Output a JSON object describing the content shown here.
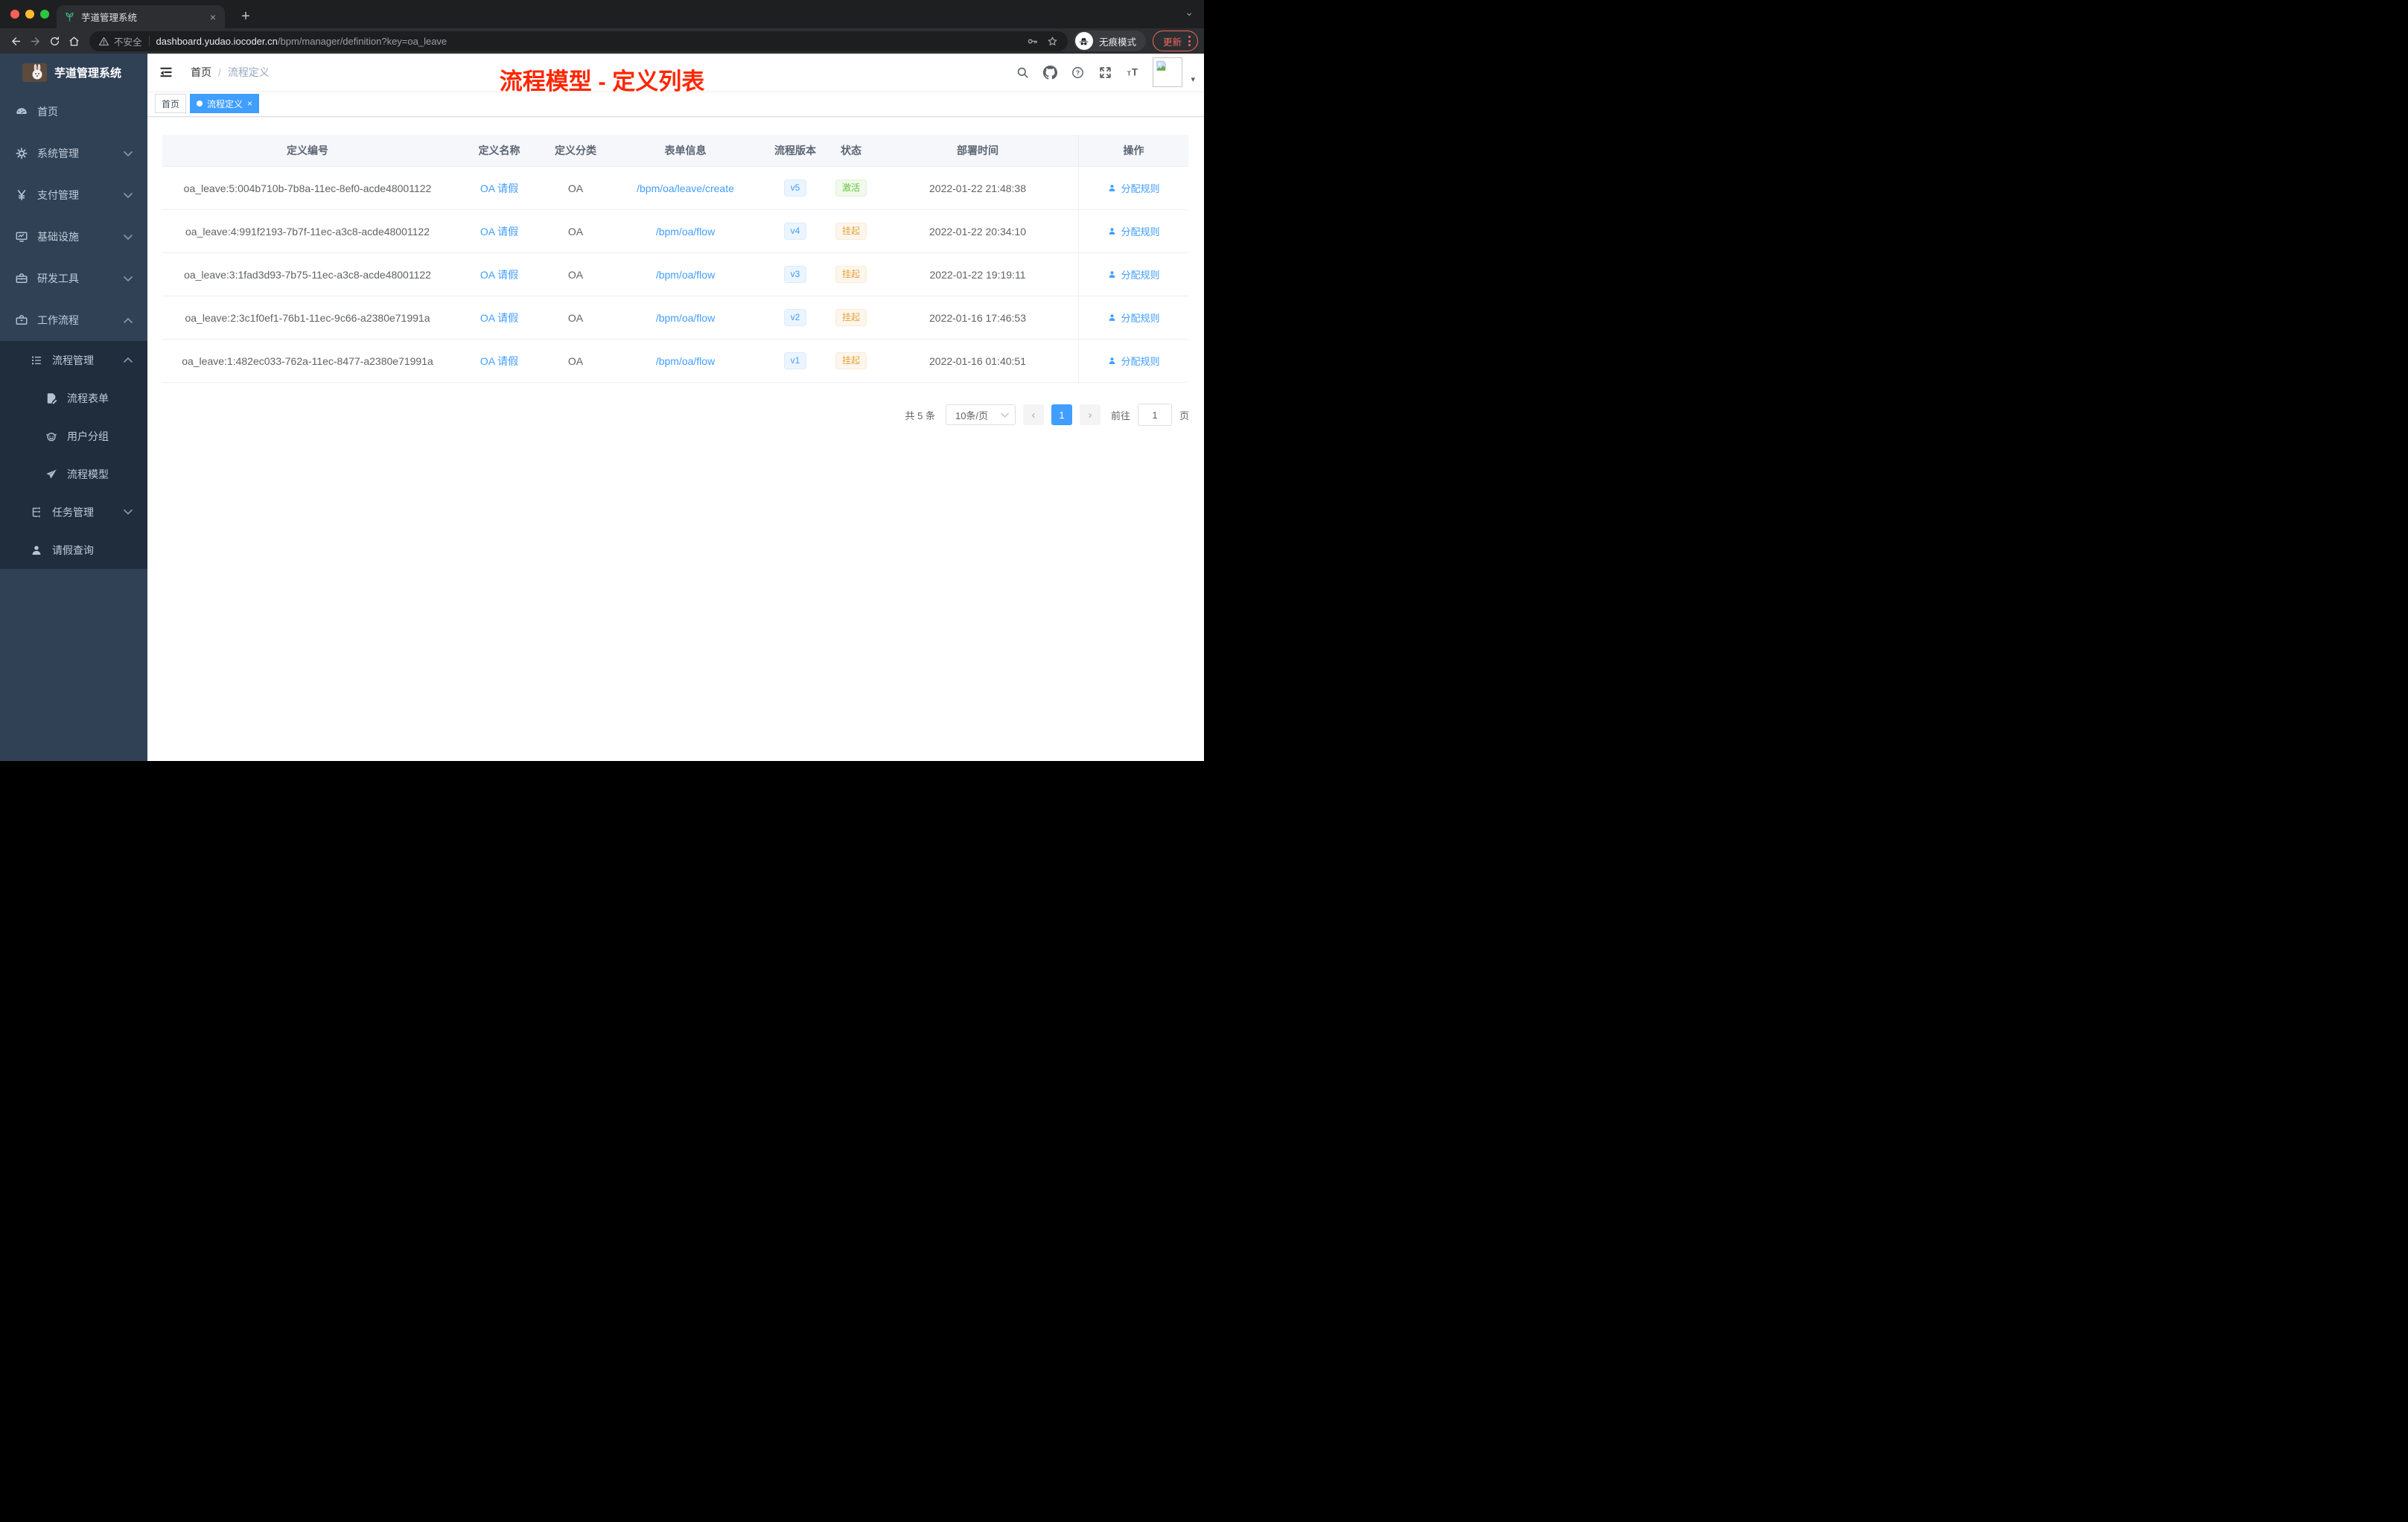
{
  "colors": {
    "accent": "#409eff",
    "title_red": "#ff2600",
    "active_green": "#67c23a",
    "warn_orange": "#e6a23c",
    "sidebar_bg": "#304156",
    "submenu_bg": "#1f2d3d"
  },
  "glyphs": {
    "close": "×",
    "plus": "+",
    "caret_down": "▾",
    "chevron_down": "⌄",
    "prev": "‹",
    "next": "›"
  },
  "browser": {
    "tab_title": "芋道管理系统",
    "security_label": "不安全",
    "url_host": "dashboard.yudao.iocoder.cn",
    "url_path": "/bpm/manager/definition?key=oa_leave",
    "incognito_label": "无痕模式",
    "update_label": "更新"
  },
  "sidebar": {
    "brand": "芋道管理系统",
    "items": [
      {
        "label": "首页",
        "icon": "dashboard-icon",
        "level": 0
      },
      {
        "label": "系统管理",
        "icon": "gear-icon",
        "level": 0,
        "chevron": "down"
      },
      {
        "label": "支付管理",
        "icon": "yen-icon",
        "level": 0,
        "chevron": "down"
      },
      {
        "label": "基础设施",
        "icon": "monitor-icon",
        "level": 0,
        "chevron": "down"
      },
      {
        "label": "研发工具",
        "icon": "toolbox-icon",
        "level": 0,
        "chevron": "down"
      },
      {
        "label": "工作流程",
        "icon": "briefcase-icon",
        "level": 0,
        "chevron": "up"
      },
      {
        "label": "流程管理",
        "icon": "list-icon",
        "level": 1,
        "chevron": "up"
      },
      {
        "label": "流程表单",
        "icon": "form-icon",
        "level": 2
      },
      {
        "label": "用户分组",
        "icon": "robot-icon",
        "level": 2
      },
      {
        "label": "流程模型",
        "icon": "paper-plane-icon",
        "level": 2
      },
      {
        "label": "任务管理",
        "icon": "tree-icon",
        "level": 1,
        "chevron": "down"
      },
      {
        "label": "请假查询",
        "icon": "user-icon",
        "level": 1
      }
    ]
  },
  "navbar": {
    "breadcrumb": [
      "首页",
      "流程定义"
    ],
    "separator": "/",
    "overlay_title": "流程模型 - 定义列表"
  },
  "tags": {
    "tabs": [
      {
        "label": "首页",
        "active": false
      },
      {
        "label": "流程定义",
        "active": true,
        "closable": true
      }
    ]
  },
  "table": {
    "columns": [
      "定义编号",
      "定义名称",
      "定义分类",
      "表单信息",
      "流程版本",
      "状态",
      "部署时间",
      "操作"
    ],
    "rows": [
      {
        "id": "oa_leave:5:004b710b-7b8a-11ec-8ef0-acde48001122",
        "name": "OA 请假",
        "category": "OA",
        "form": "/bpm/oa/leave/create",
        "version": "v5",
        "status": "激活",
        "status_type": "active",
        "deploy_time": "2022-01-22 21:48:38",
        "action": "分配规则"
      },
      {
        "id": "oa_leave:4:991f2193-7b7f-11ec-a3c8-acde48001122",
        "name": "OA 请假",
        "category": "OA",
        "form": "/bpm/oa/flow",
        "version": "v4",
        "status": "挂起",
        "status_type": "suspended",
        "deploy_time": "2022-01-22 20:34:10",
        "action": "分配规则"
      },
      {
        "id": "oa_leave:3:1fad3d93-7b75-11ec-a3c8-acde48001122",
        "name": "OA 请假",
        "category": "OA",
        "form": "/bpm/oa/flow",
        "version": "v3",
        "status": "挂起",
        "status_type": "suspended",
        "deploy_time": "2022-01-22 19:19:11",
        "action": "分配规则"
      },
      {
        "id": "oa_leave:2:3c1f0ef1-76b1-11ec-9c66-a2380e71991a",
        "name": "OA 请假",
        "category": "OA",
        "form": "/bpm/oa/flow",
        "version": "v2",
        "status": "挂起",
        "status_type": "suspended",
        "deploy_time": "2022-01-16 17:46:53",
        "action": "分配规则"
      },
      {
        "id": "oa_leave:1:482ec033-762a-11ec-8477-a2380e71991a",
        "name": "OA 请假",
        "category": "OA",
        "form": "/bpm/oa/flow",
        "version": "v1",
        "status": "挂起",
        "status_type": "suspended",
        "deploy_time": "2022-01-16 01:40:51",
        "action": "分配规则"
      }
    ]
  },
  "pagination": {
    "total_label": "共 5 条",
    "page_size_label": "10条/页",
    "current_page": "1",
    "goto_label": "前往",
    "goto_value": "1",
    "page_unit_label": "页"
  }
}
